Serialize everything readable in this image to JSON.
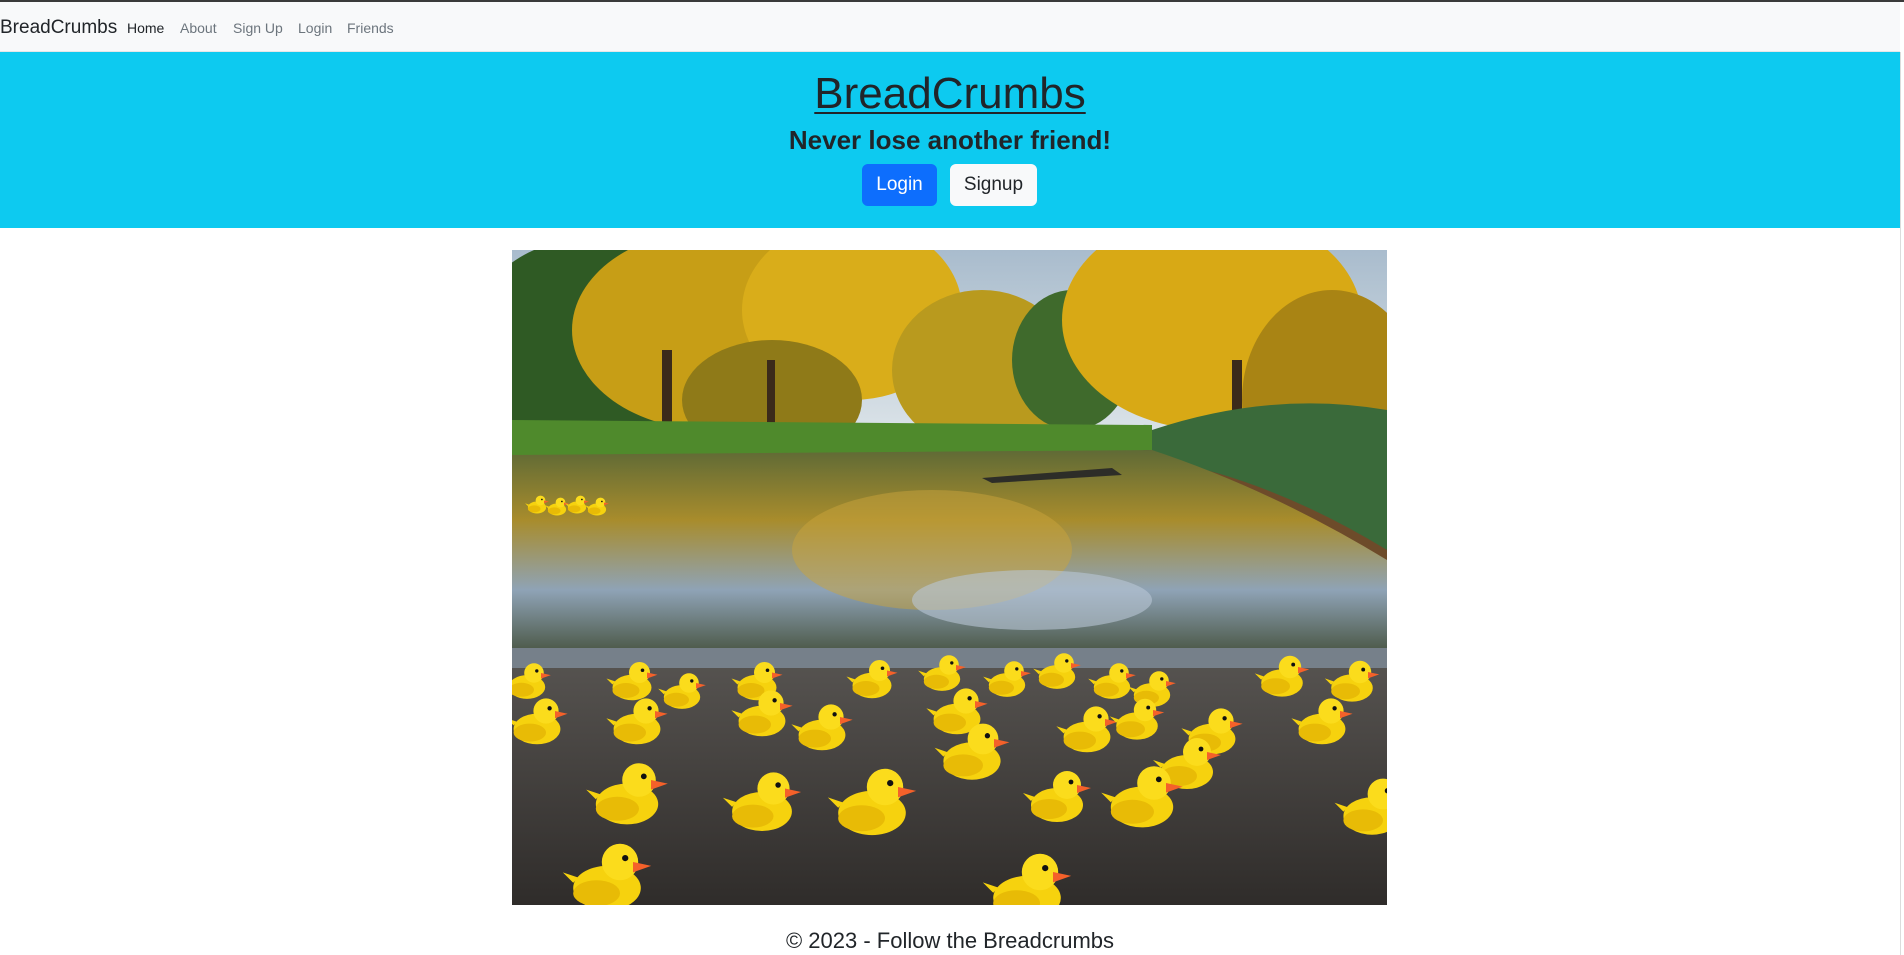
{
  "navbar": {
    "brand": "BreadCrumbs",
    "links": [
      {
        "label": "Home",
        "active": true
      },
      {
        "label": "About",
        "active": false
      },
      {
        "label": "Sign Up",
        "active": false
      },
      {
        "label": "Login",
        "active": false
      },
      {
        "label": "Friends",
        "active": false
      }
    ]
  },
  "hero": {
    "title": "BreadCrumbs",
    "subtitle": "Never lose another friend!",
    "login_label": "Login",
    "signup_label": "Signup"
  },
  "image": {
    "alt": "Rubber ducks by a pond in an autumn park"
  },
  "footer": {
    "text": "© 2023 - Follow the Breadcrumbs"
  },
  "colors": {
    "hero_background": "#0dcaf0",
    "primary_button": "#0d6efd",
    "navbar_background": "#f8f9fa",
    "text": "#212529"
  }
}
